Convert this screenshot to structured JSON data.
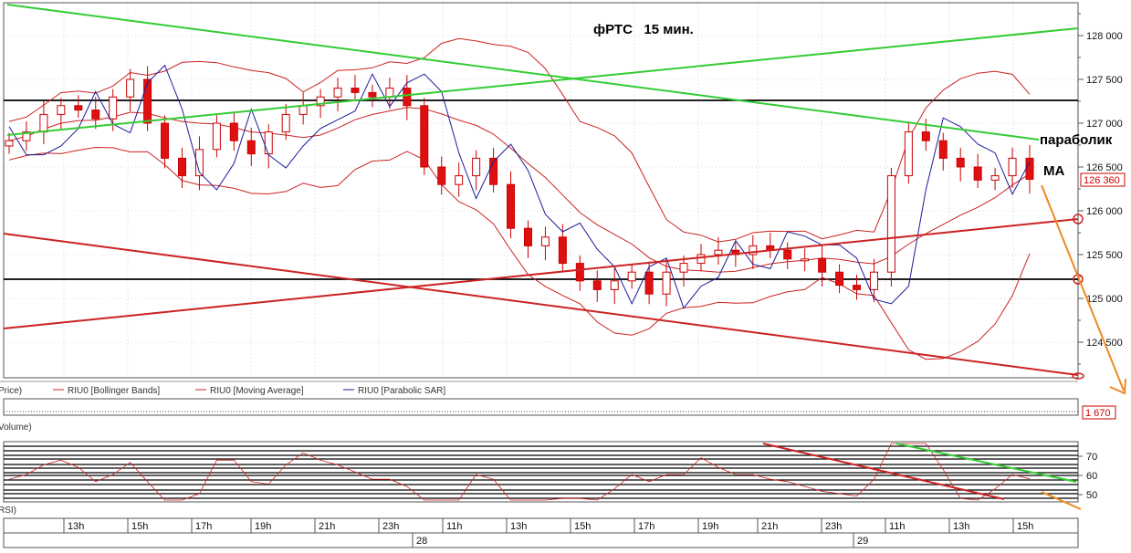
{
  "title": "фРТС   15 мин.",
  "annotations": {
    "parabolic": "параболик",
    "ma": "MA"
  },
  "price_axis": {
    "ticks": [
      "128 000",
      "127 500",
      "127 000",
      "126 500",
      "126 000",
      "125 500",
      "125 000",
      "124 500"
    ],
    "current_value": "126 360"
  },
  "legend": {
    "price": "Price)",
    "bollinger": "RIU0 [Bollinger Bands]",
    "ma": "RIU0 [Moving Average]",
    "psar": "RIU0 [Parabolic SAR]"
  },
  "volume_panel": {
    "label": "Volume)",
    "value": "1 670"
  },
  "rsi_panel": {
    "label": "RSI)",
    "ticks": [
      "70",
      "60",
      "50"
    ]
  },
  "time_axis": {
    "hours": [
      "13h",
      "15h",
      "17h",
      "19h",
      "21h",
      "23h",
      "11h",
      "13h",
      "15h",
      "17h",
      "19h",
      "21h",
      "23h",
      "11h",
      "13h",
      "15h"
    ],
    "days": [
      "28",
      "29"
    ]
  },
  "colors": {
    "bull": "#ffffff",
    "bear": "#dd1111",
    "candle_edge": "#cc0000",
    "bollinger": "#cc2222",
    "ma": "#cc2222",
    "psar": "#1a1a99",
    "trend_green": "#33cc33",
    "trend_red": "#cc2222",
    "level": "#000000",
    "forecast": "#ee8822",
    "grid": "#b8b8b8"
  },
  "chart_data": {
    "type": "candlestick",
    "title": "фРТС   15 мин.",
    "ylim": [
      124200,
      128350
    ],
    "grid": true,
    "approx_close": [
      126800,
      126900,
      127100,
      127200,
      127150,
      127050,
      127300,
      127500,
      127000,
      126600,
      126400,
      126700,
      127000,
      126800,
      126650,
      126900,
      127100,
      127200,
      127300,
      127400,
      127350,
      127300,
      127400,
      127200,
      126500,
      126300,
      126400,
      126600,
      126300,
      125800,
      125600,
      125700,
      125400,
      125200,
      125100,
      125200,
      125300,
      125050,
      125300,
      125400,
      125500,
      125550,
      125500,
      125600,
      125550,
      125450,
      125450,
      125300,
      125150,
      125100,
      125300,
      126400,
      126900,
      126800,
      126600,
      126500,
      126350,
      126400,
      126600,
      126360
    ]
  }
}
